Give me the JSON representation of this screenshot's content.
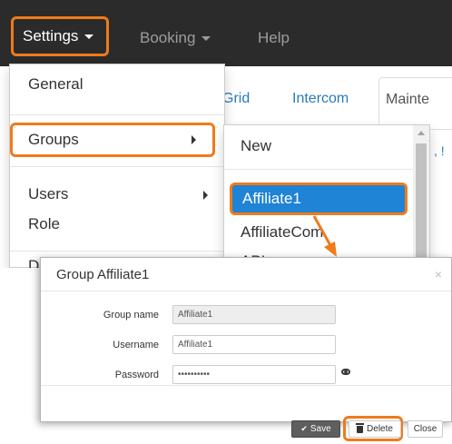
{
  "navbar": {
    "settings_label": "Settings",
    "booking_label": "Booking",
    "help_label": "Help"
  },
  "background_tabs": {
    "grid_label": "Grid",
    "intercom_label": "Intercom",
    "maintenance_label": "Mainte"
  },
  "settings_menu": {
    "items": [
      {
        "label": "General"
      },
      {
        "label": "Groups"
      },
      {
        "label": "Users"
      },
      {
        "label": "Role"
      }
    ],
    "partial_item_glyph": "D"
  },
  "groups_submenu": {
    "items": [
      {
        "label": "New"
      },
      {
        "label": "Affiliate1"
      },
      {
        "label": "AffiliateCom"
      },
      {
        "label": "API"
      }
    ],
    "peek_text": ", !"
  },
  "modal": {
    "title": "Group Affiliate1",
    "close_glyph": "×",
    "fields": {
      "group_name_label": "Group name",
      "group_name_value": "Affiliate1",
      "username_label": "Username",
      "username_value": "Affiliate1",
      "password_label": "Password",
      "password_value": "••••••••••"
    },
    "buttons": {
      "save_label": "Save",
      "delete_label": "Delete",
      "close_label": "Close"
    }
  },
  "colors": {
    "navbar_bg": "#2b2b2b",
    "highlight": "#f07b1b",
    "active_item_bg": "#1f83d6",
    "link": "#2a7ab8"
  }
}
